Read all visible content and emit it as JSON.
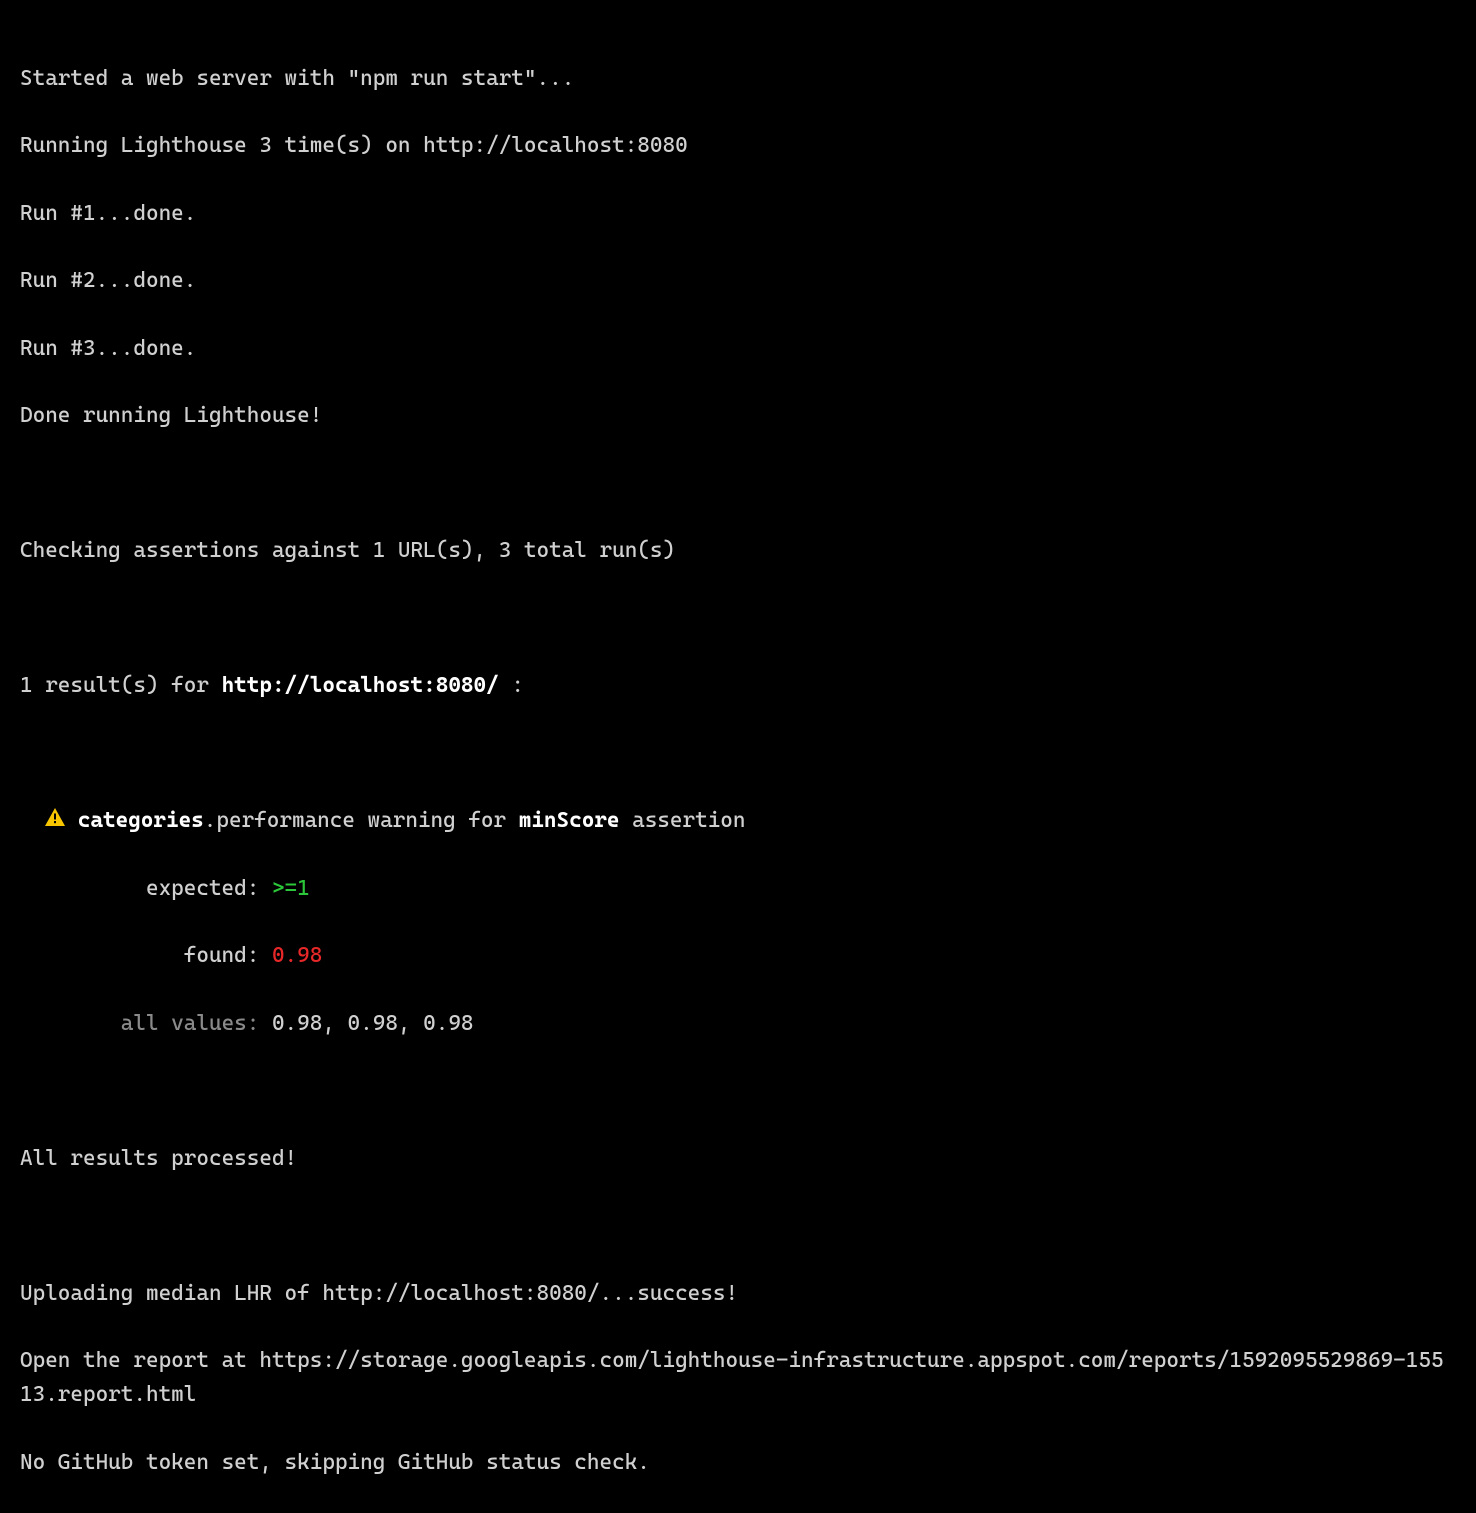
{
  "log": {
    "server_start": "Started a web server with \"npm run start\"...",
    "running": "Running Lighthouse 3 time(s) on http://localhost:8080",
    "run1": "Run #1...done.",
    "run2": "Run #2...done.",
    "run3": "Run #3...done.",
    "done_running": "Done running Lighthouse!",
    "checking": "Checking assertions against 1 URL(s), 3 total run(s)",
    "results_prefix": "1 result(s) for ",
    "results_url": "http://localhost:8080/",
    "results_suffix": " :",
    "warn": {
      "categories_bold": "categories",
      "perf_warning_text": ".performance warning for ",
      "minscore_bold": "minScore",
      "assertion_suffix": " assertion",
      "expected_label": "expected:",
      "expected_op": ">=",
      "expected_value": "1",
      "found_label": "found:",
      "found_value": "0.98",
      "all_values_label": "all values:",
      "all_values": "0.98, 0.98, 0.98"
    },
    "all_processed": "All results processed!",
    "uploading": "Uploading median LHR of http://localhost:8080/...success!",
    "open_report_prefix": "Open the report at ",
    "report_url": "https://storage.googleapis.com/lighthouse-infrastructure.appspot.com/reports/1592095529869-15513.report.html",
    "no_github_token": "No GitHub token set, skipping GitHub status check."
  }
}
